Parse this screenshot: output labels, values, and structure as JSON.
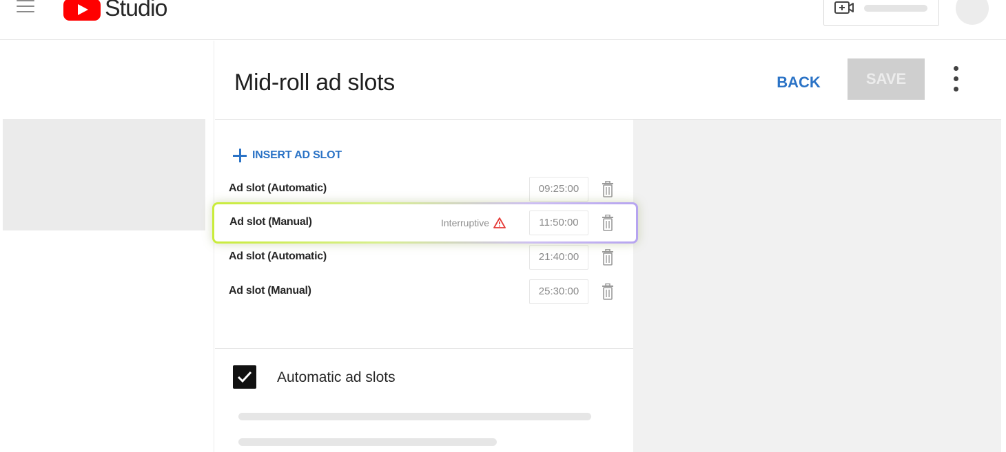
{
  "app": {
    "logo_text": "Studio"
  },
  "header": {
    "title": "Mid-roll ad slots",
    "back_label": "BACK",
    "save_label": "SAVE"
  },
  "slots": {
    "insert_label": "INSERT AD SLOT",
    "items": [
      {
        "label": "Ad slot (Automatic)",
        "time": "09:25:00",
        "status": ""
      },
      {
        "label": "Ad slot (Manual)",
        "time": "11:50:00",
        "status": "Interruptive"
      },
      {
        "label": "Ad slot (Automatic)",
        "time": "21:40:00",
        "status": ""
      },
      {
        "label": "Ad slot (Manual)",
        "time": "25:30:00",
        "status": ""
      }
    ]
  },
  "automatic": {
    "title": "Automatic ad slots",
    "checked": true
  },
  "icons": {
    "menu": "hamburger-menu-icon",
    "logo": "youtube-logo-icon",
    "create": "create-video-icon",
    "more": "more-vert-icon",
    "add": "plus-icon",
    "delete": "trash-icon",
    "warning": "warning-icon",
    "check": "checkmark-icon"
  },
  "colors": {
    "brand_red": "#ff0000",
    "link_blue": "#2b73c6",
    "warning_red": "#e53935",
    "highlight_green": "#c9ec3a",
    "highlight_purple": "#b6a4f0"
  }
}
